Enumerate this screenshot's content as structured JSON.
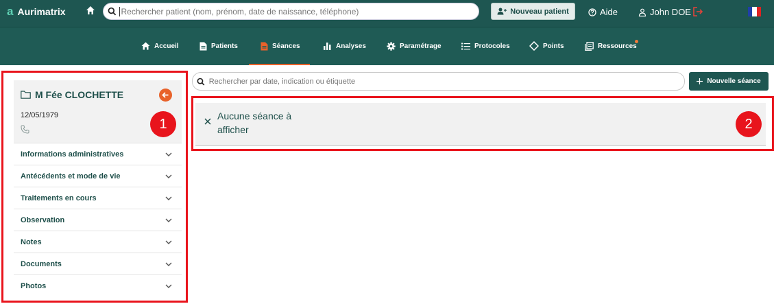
{
  "app": {
    "name": "Aurimatrix",
    "logo_mark": "a"
  },
  "topbar": {
    "search_placeholder": "Rechercher patient (nom, prénom, date de naissance, téléphone)",
    "new_patient_label": "Nouveau patient",
    "help_label": "Aide",
    "user_label": "John DOE",
    "flag": {
      "colors": [
        "#1f3fa8",
        "#ffffff",
        "#e02222"
      ]
    }
  },
  "nav": {
    "items": [
      {
        "label": "Accueil",
        "icon": "home-icon"
      },
      {
        "label": "Patients",
        "icon": "document-icon"
      },
      {
        "label": "Séances",
        "icon": "session-doc-icon"
      },
      {
        "label": "Analyses",
        "icon": "bar-chart-icon"
      },
      {
        "label": "Paramétrage",
        "icon": "gear-icon"
      },
      {
        "label": "Protocoles",
        "icon": "list-icon"
      },
      {
        "label": "Points",
        "icon": "diamond-icon"
      },
      {
        "label": "Ressources",
        "icon": "library-icon"
      }
    ],
    "active": "Séances",
    "accent_color": "#e8622a"
  },
  "patient": {
    "name": "M Fée CLOCHETTE",
    "dob": "12/05/1979"
  },
  "accordion": [
    {
      "label": "Informations administratives"
    },
    {
      "label": "Antécédents et mode de vie"
    },
    {
      "label": "Traitements en cours"
    },
    {
      "label": "Observation"
    },
    {
      "label": "Notes"
    },
    {
      "label": "Documents"
    },
    {
      "label": "Photos"
    }
  ],
  "sessions": {
    "search_placeholder": "Rechercher par date, indication ou étiquette",
    "new_session_label": "Nouvelle séance",
    "empty_message": "Aucune séance à afficher"
  },
  "annotations": {
    "badge_1": "1",
    "badge_2": "2",
    "highlight_color": "#e9141c"
  },
  "colors": {
    "primary": "#1e5651",
    "accent": "#e8622a"
  }
}
